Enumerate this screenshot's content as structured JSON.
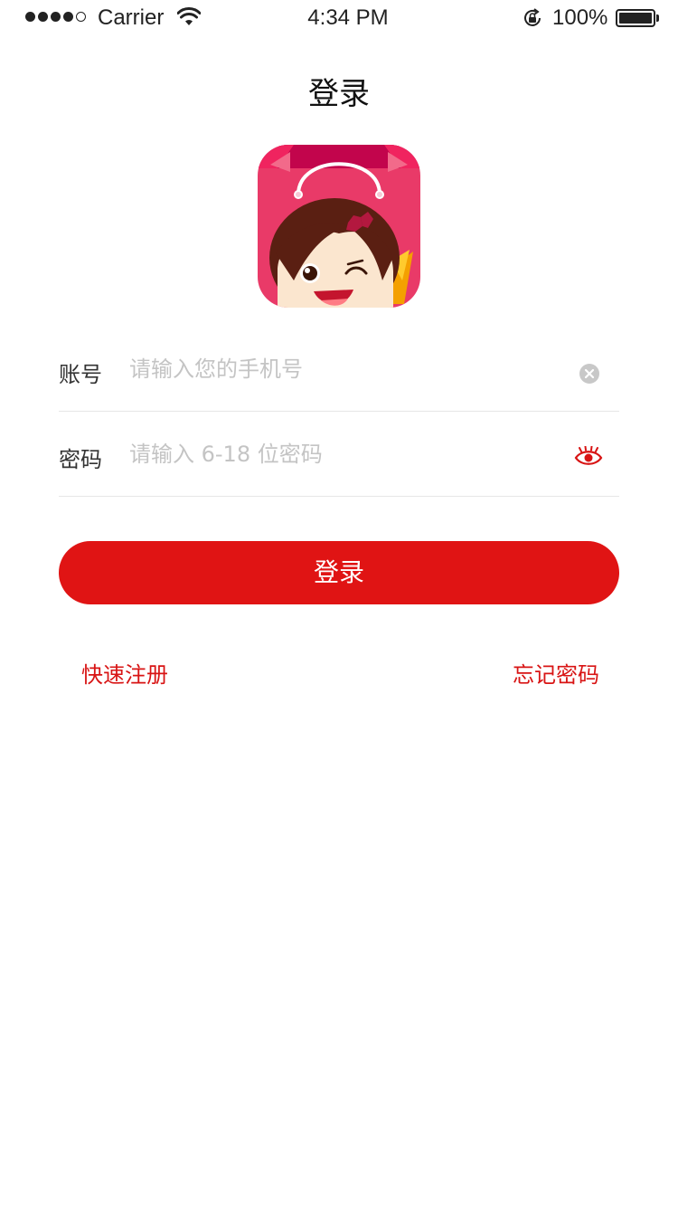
{
  "status_bar": {
    "carrier": "Carrier",
    "time": "4:34 PM",
    "battery_percent": "100%",
    "signal_bars_filled": 4,
    "signal_bars_total": 5,
    "battery_level": 1.0
  },
  "header": {
    "title": "登录"
  },
  "logo": {
    "icon": "shopping-bag-girl-logo"
  },
  "form": {
    "account": {
      "label": "账号",
      "placeholder": "请输入您的手机号",
      "value": "",
      "trailing_icon": "clear-icon"
    },
    "password": {
      "label": "密码",
      "placeholder": "请输入 6-18 位密码",
      "value": "",
      "trailing_icon": "eye-icon"
    }
  },
  "actions": {
    "login_label": "登录",
    "register_label": "快速注册",
    "forgot_label": "忘记密码"
  },
  "colors": {
    "accent": "#e01414",
    "link": "#d81414",
    "placeholder": "#c4c4c4",
    "divider": "#e6e6e6"
  }
}
